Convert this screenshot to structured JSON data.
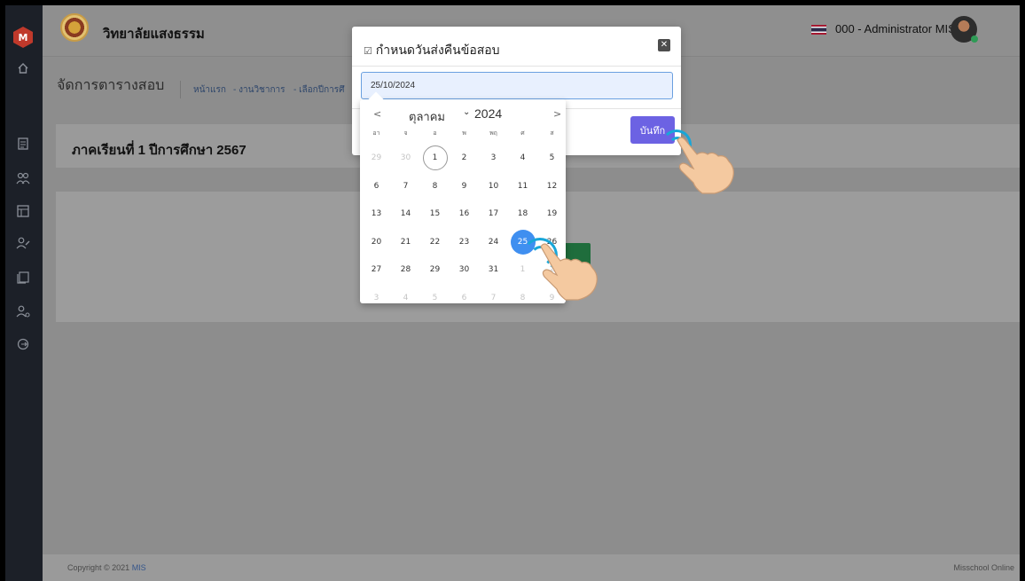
{
  "sidebar": {
    "logo_letter": "M",
    "icons": [
      "home-icon",
      "document-icon",
      "users-icon",
      "table-icon",
      "user-edit-icon",
      "book-icon",
      "user-settings-icon",
      "logout-icon"
    ]
  },
  "header": {
    "school_name": "วิทยาลัยแสงธรรม",
    "user_name": "000 - Administrator MIS"
  },
  "breadcrumb": {
    "page_title": "จัดการตารางสอบ",
    "items": [
      "หน้าแรก",
      "- งานวิชาการ",
      "- เลือกปีการศึ"
    ]
  },
  "semester": {
    "title": "ภาคเรียนที่ 1 ปีการศึกษา 2567"
  },
  "footer": {
    "copyright_prefix": "Copyright © 2021",
    "copyright_brand": "MIS",
    "right_text": "Misschool Online"
  },
  "modal": {
    "title_icon": "☑",
    "title": "กำหนดวันส่งคืนข้อสอบ",
    "close_label": "✕",
    "date_value": "25/10/2024",
    "save_label": "บันทึก"
  },
  "datepicker": {
    "prev_label": "<",
    "next_label": ">",
    "month": "ตุลาคม",
    "year_chevron": "⌄",
    "year": "2024",
    "weekdays": [
      "อา",
      "จ",
      "อ",
      "พ",
      "พฤ",
      "ศ",
      "ส"
    ],
    "weeks": [
      [
        "29",
        "30",
        "1",
        "2",
        "3",
        "4",
        "5"
      ],
      [
        "6",
        "7",
        "8",
        "9",
        "10",
        "11",
        "12"
      ],
      [
        "13",
        "14",
        "15",
        "16",
        "17",
        "18",
        "19"
      ],
      [
        "20",
        "21",
        "22",
        "23",
        "24",
        "25",
        "26"
      ],
      [
        "27",
        "28",
        "29",
        "30",
        "31",
        "1",
        "2"
      ],
      [
        "3",
        "4",
        "5",
        "6",
        "7",
        "8",
        "9"
      ]
    ],
    "today": "1",
    "selected": "25"
  },
  "colors": {
    "accent": "#6c62e3",
    "selected_day": "#3f8ff0",
    "sidebar": "#1c2028",
    "tap_ring": "#18a6d8"
  }
}
